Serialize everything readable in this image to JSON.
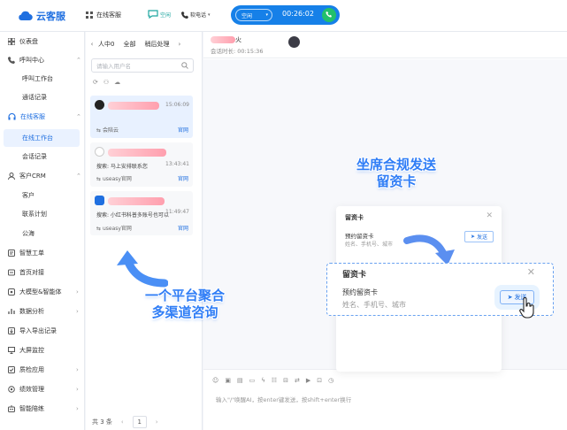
{
  "app": {
    "name": "云客服"
  },
  "topnav": {
    "online_label": "在线客服",
    "status_label": "空闲",
    "phone_label": "软电话"
  },
  "call": {
    "state": "空闲",
    "timer": "00:26:02"
  },
  "sidebar": {
    "items": [
      {
        "label": "仪表盘",
        "icon": "dashboard-icon"
      },
      {
        "label": "呼叫中心",
        "icon": "phone-icon"
      },
      {
        "label": "呼叫工作台"
      },
      {
        "label": "通话记录"
      },
      {
        "label": "在线客服",
        "icon": "headset-icon"
      },
      {
        "label": "在线工作台"
      },
      {
        "label": "会话记录"
      },
      {
        "label": "客户CRM",
        "icon": "user-icon"
      },
      {
        "label": "客户"
      },
      {
        "label": "联系计划"
      },
      {
        "label": "公海"
      },
      {
        "label": "智慧工单",
        "icon": "ticket-icon"
      },
      {
        "label": "首页对接",
        "icon": "plug-icon"
      },
      {
        "label": "大模型&智能体",
        "icon": "ai-icon"
      },
      {
        "label": "数据分析",
        "icon": "chart-icon"
      },
      {
        "label": "导入导出记录",
        "icon": "import-icon"
      },
      {
        "label": "大屏监控",
        "icon": "monitor-icon"
      },
      {
        "label": "质检应用",
        "icon": "check-icon"
      },
      {
        "label": "绩效管理",
        "icon": "medal-icon"
      },
      {
        "label": "智能陪练",
        "icon": "robot-icon"
      }
    ]
  },
  "convlist": {
    "tabs": [
      "人中0",
      "全部",
      "稍后处理"
    ],
    "search_placeholder": "请输入用户名",
    "conversations": [
      {
        "time": "15:06:09",
        "message": "",
        "source": "会陪云",
        "channel": "官网"
      },
      {
        "time": "13:43:41",
        "message": "搜索: 马上安排联系您",
        "source": "useasy官网",
        "channel": "官网"
      },
      {
        "time": "11:49:47",
        "message": "搜索: 小红书科普多账号也可以",
        "source": "useasy官网",
        "channel": "官网"
      }
    ],
    "total": "共 3 条",
    "page": "1"
  },
  "chat": {
    "name_suffix": "火",
    "duration": "会话时长: 00:15:36"
  },
  "leave_info_card": {
    "title": "留资卡",
    "subtitle": "预约留资卡",
    "fields": "姓名、手机号、城市",
    "send_label": "发送"
  },
  "annotations": {
    "right_line1": "坐席合规发送",
    "right_line2": "留资卡",
    "left_line1": "一个平台聚合",
    "left_line2": "多渠道咨询"
  },
  "composer": {
    "placeholder": "输入\"/\"唤醒AI，按enter键发送，按shift+enter换行"
  },
  "colors": {
    "brand": "#1f6fe0",
    "call_pill": "#1680e8",
    "call_button": "#22c06c",
    "annotation": "#2f7df6"
  }
}
